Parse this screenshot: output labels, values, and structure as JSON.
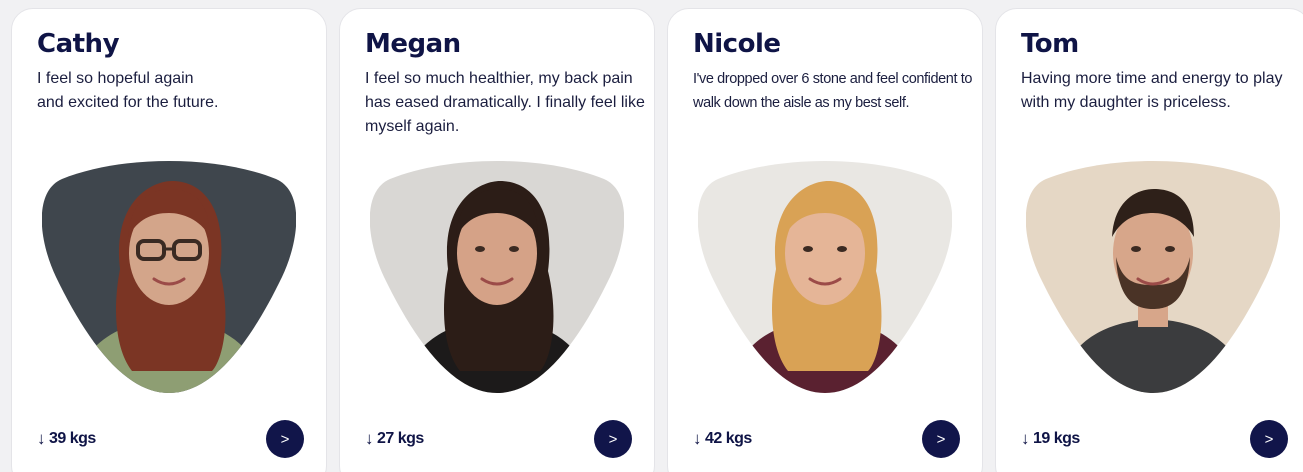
{
  "cards": [
    {
      "name": "Cathy",
      "quote": "I feel so hopeful again\nand excited for the future.",
      "loss_arrow": "↓",
      "loss": "39 kgs",
      "next_label": ">",
      "photo": {
        "bg": "#3f464d",
        "skin": "#d3a58a",
        "hair": "#7b3524",
        "clothes": "#8e9e73",
        "glasses": true,
        "beard": false
      }
    },
    {
      "name": "Megan",
      "quote": "I feel so much healthier, my back pain has eased dramatically. I finally feel like myself again.",
      "loss_arrow": "↓",
      "loss": "27 kgs",
      "next_label": ">",
      "photo": {
        "bg": "#d9d7d4",
        "skin": "#d5a287",
        "hair": "#2c1d17",
        "clothes": "#1c1a1a",
        "glasses": false,
        "beard": false
      }
    },
    {
      "name": "Nicole",
      "quote": "I've dropped over 6 stone and feel confident to walk down the aisle as my best self.",
      "loss_arrow": "↓",
      "loss": "42 kgs",
      "next_label": ">",
      "photo": {
        "bg": "#e9e7e3",
        "skin": "#e5b597",
        "hair": "#d9a255",
        "clothes": "#5a2130",
        "glasses": false,
        "beard": false
      }
    },
    {
      "name": "Tom",
      "quote": "Having more time and energy to play with my daughter is priceless.",
      "loss_arrow": "↓",
      "loss": "19 kgs",
      "next_label": ">",
      "photo": {
        "bg": "#e5d7c5",
        "skin": "#d7a68a",
        "hair": "#2e2019",
        "clothes": "#3b3c3e",
        "glasses": false,
        "beard": true
      }
    }
  ]
}
